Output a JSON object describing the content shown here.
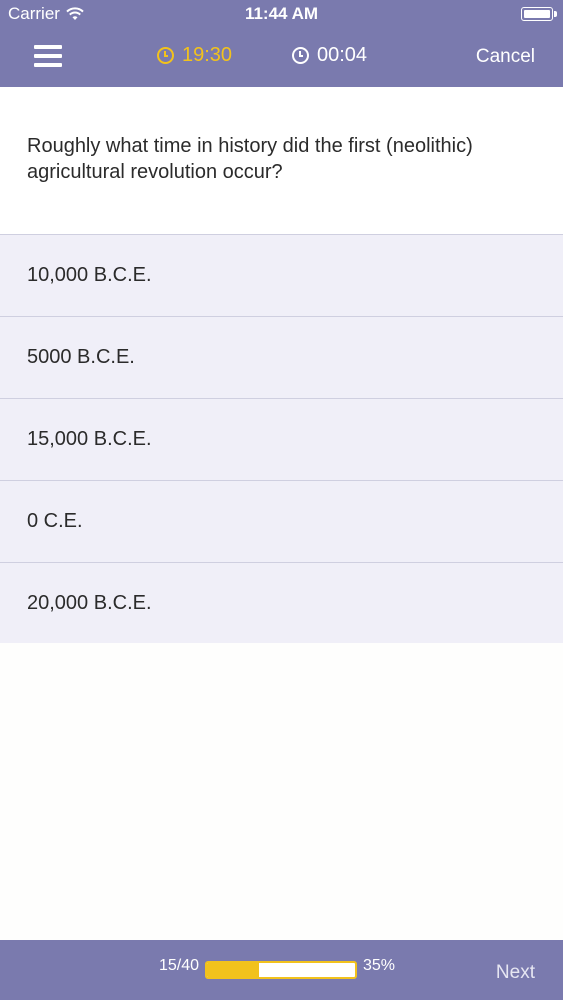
{
  "status_bar": {
    "carrier": "Carrier",
    "time": "11:44 AM",
    "wifi_icon": "wifi-icon",
    "battery_icon": "battery-icon"
  },
  "nav": {
    "menu_icon": "hamburger-menu-icon",
    "countdown": "19:30",
    "elapsed": "00:04",
    "cancel_label": "Cancel"
  },
  "question": {
    "text": "Roughly what time in history did the first (neolithic) agricultural revolution occur?"
  },
  "answers": [
    {
      "label": "10,000 B.C.E."
    },
    {
      "label": "5000 B.C.E."
    },
    {
      "label": "15,000 B.C.E."
    },
    {
      "label": "0 C.E."
    },
    {
      "label": "20,000 B.C.E."
    }
  ],
  "footer": {
    "progress_count": "15/40",
    "progress_percent": "35%",
    "progress_value": 0.35,
    "next_label": "Next"
  },
  "colors": {
    "primary": "#7a7aae",
    "accent": "#f2c21c",
    "answer_bg": "#f0eff8"
  }
}
